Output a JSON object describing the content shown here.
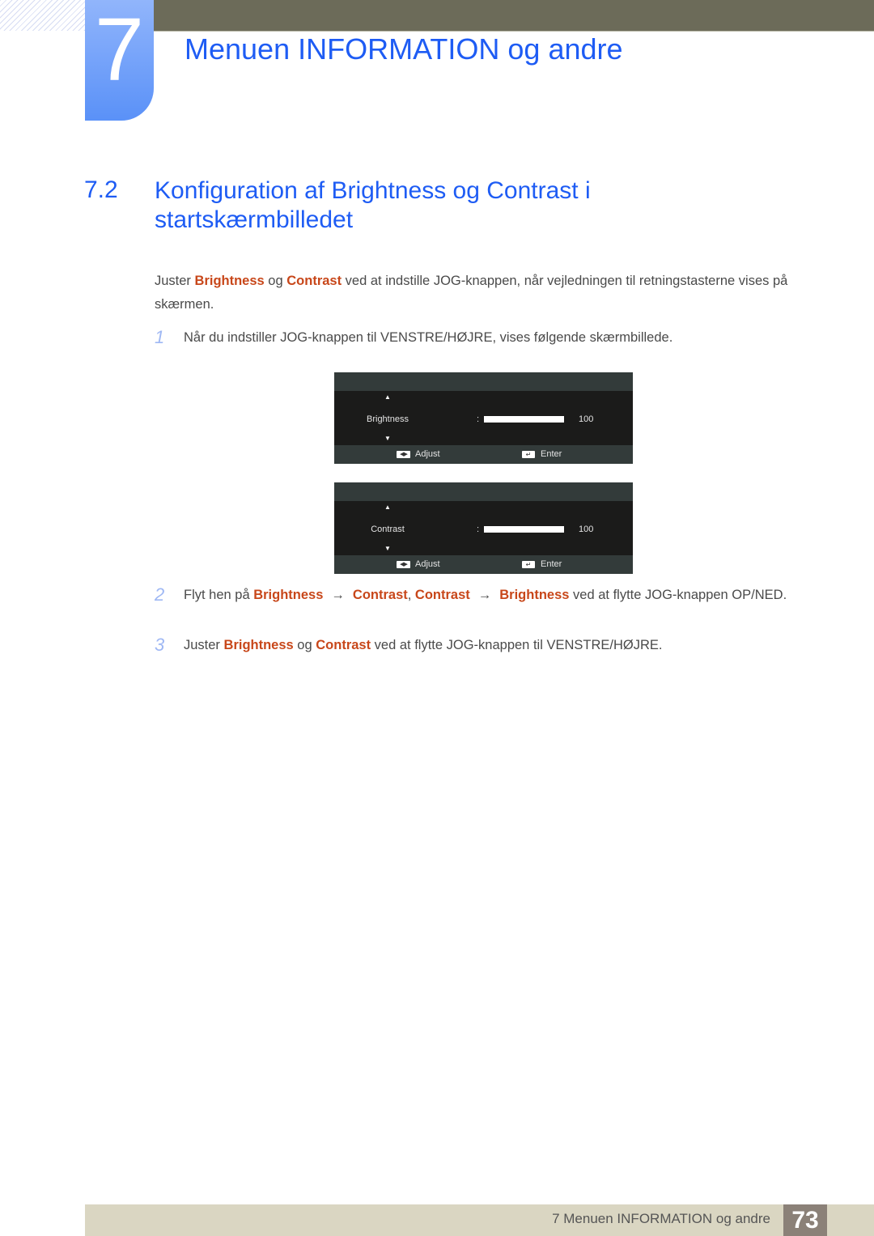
{
  "chapter": {
    "number": "7",
    "title": "Menuen INFORMATION og andre"
  },
  "section": {
    "number": "7.2",
    "title": "Konfiguration af Brightness og Contrast i startskærmbilledet"
  },
  "intro": {
    "p1": "Juster ",
    "hl1": "Brightness",
    "p2": " og ",
    "hl2": "Contrast",
    "p3": " ved at indstille JOG-knappen, når vejledningen til retningstasterne vises på skærmen."
  },
  "steps": [
    {
      "num": "1",
      "text": "Når du indstiller JOG-knappen til VENSTRE/HØJRE, vises følgende skærmbillede."
    },
    {
      "num": "2",
      "t1": "Flyt hen på ",
      "h1": "Brightness",
      "arrow": "→",
      "h2": "Contrast",
      "t2": ", ",
      "h3": "Contrast",
      "h4": "Brightness",
      "t3": " ved at flytte JOG-knappen OP/NED."
    },
    {
      "num": "3",
      "t1": "Juster ",
      "h1": "Brightness",
      "t2": " og ",
      "h2": "Contrast",
      "t3": " ved at flytte JOG-knappen til VENSTRE/HØJRE."
    }
  ],
  "osd": [
    {
      "label": "Brightness",
      "colon": ":",
      "value": "100",
      "level_percent": 100,
      "up_icon": "▲",
      "down_icon": "▼",
      "adjust_icon": "◀▶",
      "adjust_label": "Adjust",
      "enter_icon": "↵",
      "enter_label": "Enter"
    },
    {
      "label": "Contrast",
      "colon": ":",
      "value": "100",
      "level_percent": 100,
      "up_icon": "▲",
      "down_icon": "▼",
      "adjust_icon": "◀▶",
      "adjust_label": "Adjust",
      "enter_icon": "↵",
      "enter_label": "Enter"
    }
  ],
  "footer": {
    "text": "7 Menuen INFORMATION og andre",
    "page": "73"
  },
  "colors": {
    "heading": "#1e5cf4",
    "highlight": "#c8471a",
    "topbar": "#6c6b59",
    "footer": "#dad6c2",
    "page_box": "#8b8178"
  }
}
